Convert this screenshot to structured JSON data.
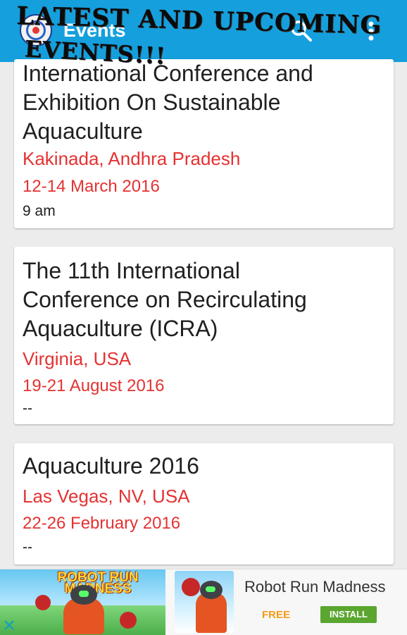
{
  "appbar": {
    "title": "Events",
    "banner_line1": "LATEST AND UPCOMING",
    "banner_line2": "EVENTS!!!",
    "search_icon": "search-icon",
    "menu_icon": "overflow-menu-icon"
  },
  "events": [
    {
      "title_lines": [
        "International Conference and",
        "Exhibition On Sustainable",
        "Aquaculture"
      ],
      "location": "Kakinada, Andhra Pradesh",
      "date": "12-14 March 2016",
      "time": "9 am"
    },
    {
      "title_lines": [
        " The 11th International",
        "Conference on Recirculating",
        "Aquaculture (ICRA)"
      ],
      "location": "Virginia, USA",
      "date": "19-21 August 2016",
      "time": "--"
    },
    {
      "title_lines": [
        "Aquaculture 2016"
      ],
      "location": "Las Vegas, NV, USA",
      "date": "22-26 February 2016",
      "time": "--"
    }
  ],
  "ad": {
    "game_title_line1": "ROBOT RUN",
    "game_title_line2": "MADNESS",
    "app_name": "Robot Run Madness",
    "price": "FREE",
    "install_label": "INSTALL",
    "close_icon": "close-icon"
  },
  "colors": {
    "appbar": "#159fdd",
    "accent_text": "#e43232",
    "install": "#5aa62f",
    "free": "#f29b16"
  }
}
